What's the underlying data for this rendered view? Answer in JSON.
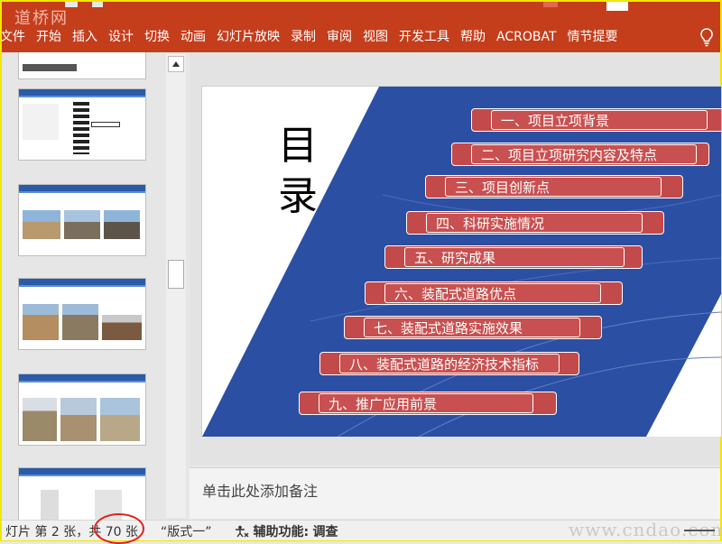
{
  "ribbon": {
    "watermark": "道桥网",
    "tabs": [
      "文件",
      "开始",
      "插入",
      "设计",
      "切换",
      "动画",
      "幻灯片放映",
      "录制",
      "审阅",
      "视图",
      "开发工具",
      "帮助",
      "ACROBAT",
      "情节提要"
    ],
    "icons": {
      "help": "lightbulb-icon"
    },
    "colors": {
      "background": "#c43e1c",
      "text": "#ffffff"
    }
  },
  "slide": {
    "title": "目录",
    "items": [
      "一、项目立项背景",
      "二、项目立项研究内容及特点",
      "三、项目创新点",
      "四、科研实施情况",
      "五、研究成果",
      "六、装配式道路优点",
      "七、装配式道路实施效果",
      "八、装配式道路的经济技术指标",
      "九、推广应用前景"
    ],
    "colors": {
      "band": "#2b4fa3",
      "item": "#c24a4a",
      "item_text": "#ffffff"
    }
  },
  "notes": {
    "placeholder": "单击此处添加备注"
  },
  "status": {
    "slide_prefix": "灯片 第 2 张，",
    "slide_total": "共 70 张",
    "layout": "“版式一”",
    "accessibility_label": "辅助功能:",
    "accessibility_value": "调查",
    "watermark": "www.cndao.com"
  }
}
